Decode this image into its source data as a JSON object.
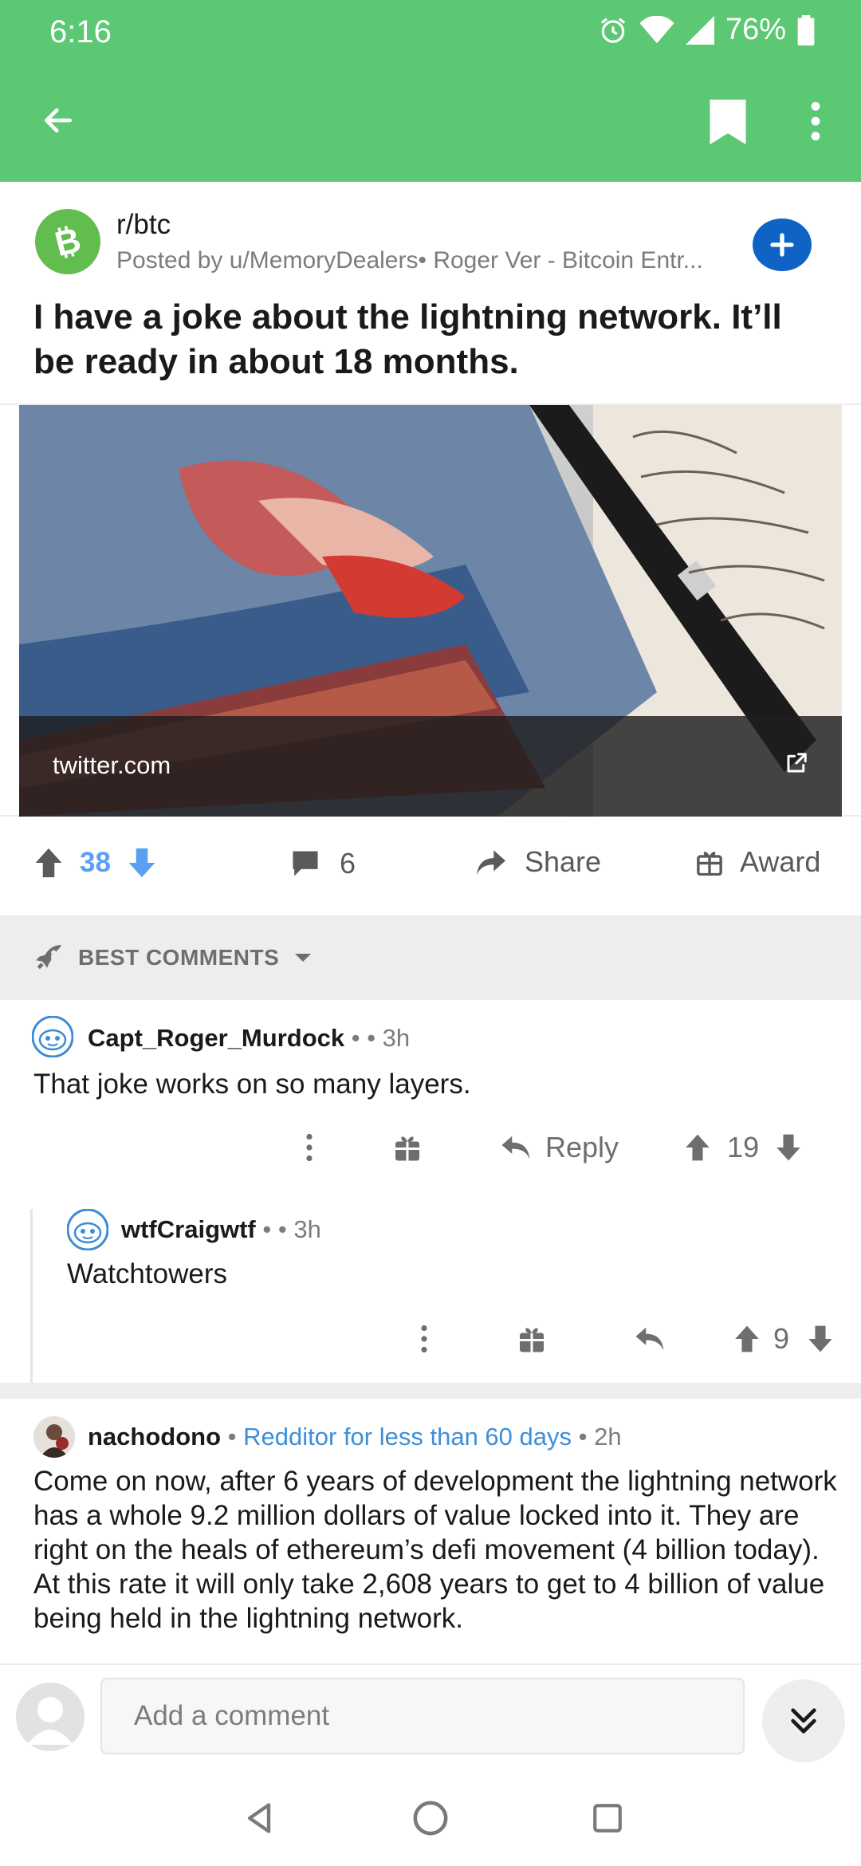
{
  "status_bar": {
    "time": "6:16",
    "battery": "76%"
  },
  "post": {
    "subreddit": "r/btc",
    "posted_by": "Posted by u/MemoryDealers• Roger Ver - Bitcoin Entr...",
    "title": "I have a joke about the lightning network. It’ll be ready in about 18 months.",
    "link_domain": "twitter.com",
    "score": "38",
    "comments_count": "6",
    "share_label": "Share",
    "award_label": "Award"
  },
  "sort": {
    "label": "BEST COMMENTS"
  },
  "comments": [
    {
      "author": "Capt_Roger_Murdock",
      "separator": "• • 3h",
      "body": "That joke works on so many layers.",
      "reply_label": "Reply",
      "score": "19"
    },
    {
      "author": "wtfCraigwtf",
      "separator": "• • 3h",
      "body": "Watchtowers",
      "score": "9"
    },
    {
      "author": "nachodono",
      "dot1": "•",
      "flair": "Redditor for less than 60 days",
      "time": "• 2h",
      "body": "Come on now, after 6 years of development the lightning network has a whole 9.2 million dollars of value locked into it. They are right on the heals of ethereum’s defi movement (4 billion today). At this rate it will only take 2,608 years to get to 4 billion of value being held in the lightning network."
    }
  ],
  "compose": {
    "placeholder": "Add a comment"
  },
  "colors": {
    "app_bar": "#5cc873",
    "upvote": "#5b9ff3",
    "flair": "#3d8fd8",
    "join": "#0e63c4"
  }
}
